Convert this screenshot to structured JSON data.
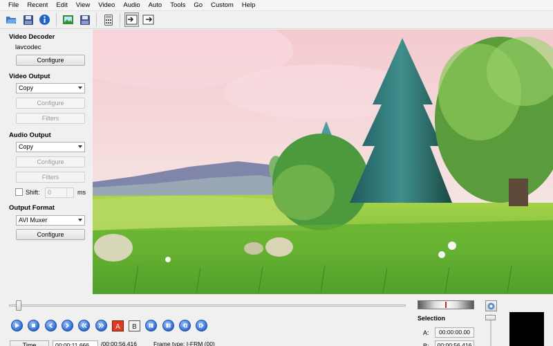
{
  "menu": [
    "File",
    "Recent",
    "Edit",
    "View",
    "Video",
    "Audio",
    "Auto",
    "Tools",
    "Go",
    "Custom",
    "Help"
  ],
  "toolbar": {
    "icons": [
      "open-icon",
      "save-icon",
      "info-icon",
      "save-image-icon",
      "save-script-icon",
      "calculator-icon",
      "input-preview-icon",
      "output-preview-icon"
    ]
  },
  "video_decoder": {
    "title": "Video Decoder",
    "codec": "lavcodec",
    "configure": "Configure"
  },
  "video_output": {
    "title": "Video Output",
    "selected": "Copy",
    "configure": "Configure",
    "filters": "Filters"
  },
  "audio_output": {
    "title": "Audio Output",
    "selected": "Copy",
    "configure": "Configure",
    "filters": "Filters",
    "shift_label": "Shift:",
    "shift_value": "0",
    "shift_unit": "ms"
  },
  "output_format": {
    "title": "Output Format",
    "selected": "AVI Muxer",
    "configure": "Configure"
  },
  "playback": {
    "progress": 0.025,
    "buttons": [
      "play",
      "stop",
      "previous-frame",
      "next-frame",
      "back-keyframe",
      "forward-keyframe",
      "set-marker-a",
      "set-marker-b",
      "go-marker-a",
      "go-marker-b",
      "back-black",
      "forward-black"
    ]
  },
  "selection": {
    "title": "Selection",
    "a_label": "A:",
    "a_value": "00:00:00.00",
    "b_label": "B:",
    "b_value": "00:00:56.416"
  },
  "time": {
    "button": "Time",
    "current": "00:00:11.666",
    "total": "/00:00:56.416",
    "frame_type": "Frame type: I-FRM (00)"
  }
}
